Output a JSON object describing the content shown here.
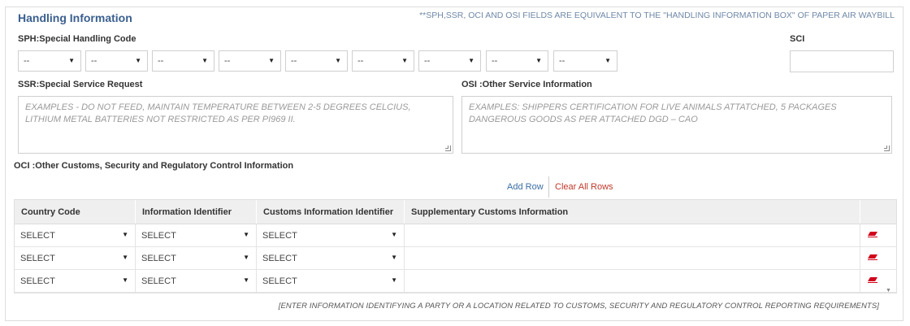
{
  "section": {
    "title": "Handling Information",
    "notice": "**SPH,SSR, OCI AND OSI FIELDS ARE EQUIVALENT TO THE \"HANDLING INFORMATION BOX\" OF PAPER AIR WAYBILL"
  },
  "sph": {
    "label": "SPH:Special Handling Code",
    "selects": [
      "--",
      "--",
      "--",
      "--",
      "--",
      "--",
      "--",
      "--",
      "--"
    ]
  },
  "sci": {
    "label": "SCI",
    "value": ""
  },
  "ssr": {
    "label": "SSR:Special Service Request",
    "placeholder": "EXAMPLES - DO NOT FEED, MAINTAIN TEMPERATURE BETWEEN 2-5 DEGREES CELCIUS, LITHIUM METAL BATTERIES NOT RESTRICTED AS PER PI969 II."
  },
  "osi": {
    "label": "OSI :Other Service Information",
    "placeholder": "EXAMPLES: SHIPPERS CERTIFICATION FOR LIVE ANIMALS ATTATCHED, 5 PACKAGES DANGEROUS GOODS AS PER ATTACHED DGD – CAO"
  },
  "oci": {
    "label": "OCI :Other Customs, Security and Regulatory Control Information",
    "add_row": "Add Row",
    "clear_rows": "Clear All Rows",
    "columns": [
      "Country Code",
      "Information Identifier",
      "Customs Information Identifier",
      "Supplementary Customs Information"
    ],
    "rows": [
      {
        "country": "SELECT",
        "info_id": "SELECT",
        "customs_id": "SELECT",
        "supplementary": ""
      },
      {
        "country": "SELECT",
        "info_id": "SELECT",
        "customs_id": "SELECT",
        "supplementary": ""
      },
      {
        "country": "SELECT",
        "info_id": "SELECT",
        "customs_id": "SELECT",
        "supplementary": ""
      }
    ],
    "footnote": "[ENTER INFORMATION IDENTIFYING A PARTY OR A LOCATION RELATED TO CUSTOMS, SECURITY AND REGULATORY CONTROL REPORTING REQUIREMENTS]"
  },
  "icons": {
    "caret": "caret-down-icon",
    "delete": "eraser-delete-icon",
    "scroll": "scroll-down-icon"
  },
  "colors": {
    "title": "#3a5f8f",
    "add_link": "#3a6ea5",
    "clear_link": "#c0392b",
    "delete_icon": "#d0021b"
  }
}
